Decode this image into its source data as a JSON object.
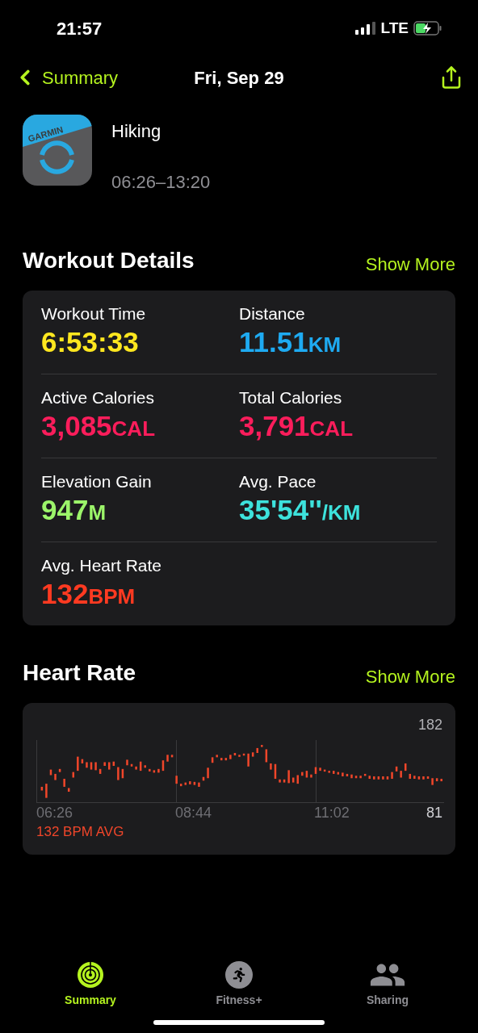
{
  "status_bar": {
    "time": "21:57",
    "network": "LTE"
  },
  "nav": {
    "back": "Summary",
    "title": "Fri, Sep 29"
  },
  "workout": {
    "icon_text": "GARMIN",
    "name": "Hiking",
    "time_range": "06:26–13:20"
  },
  "details": {
    "title": "Workout Details",
    "action": "Show More",
    "metrics": [
      {
        "label": "Workout Time",
        "value": "6:53:33",
        "color": "#ffe71f"
      },
      {
        "label": "Distance",
        "value": "11.51",
        "unit": "KM",
        "color": "#1eaaf1"
      },
      {
        "label": "Active Calories",
        "value": "3,085",
        "unit": "CAL",
        "color": "#fa1d5b"
      },
      {
        "label": "Total Calories",
        "value": "3,791",
        "unit": "CAL",
        "color": "#fa1d5b"
      },
      {
        "label": "Elevation Gain",
        "value": "947",
        "unit": "M",
        "color": "#9cf56a"
      },
      {
        "label": "Avg. Pace",
        "value": "35'54''",
        "unit": "/KM",
        "color": "#3de2dc"
      },
      {
        "label": "Avg. Heart Rate",
        "value": "132",
        "unit": "BPM",
        "color": "#ff3a21"
      }
    ]
  },
  "heart_rate": {
    "title": "Heart Rate",
    "action": "Show More",
    "max_label": "182",
    "min_label": "81",
    "time_labels": [
      "06:26",
      "08:44",
      "11:02"
    ],
    "average": "132 BPM AVG"
  },
  "tabs": [
    {
      "label": "Summary",
      "selected": true
    },
    {
      "label": "Fitness+",
      "selected": false
    },
    {
      "label": "Sharing",
      "selected": false
    }
  ]
}
